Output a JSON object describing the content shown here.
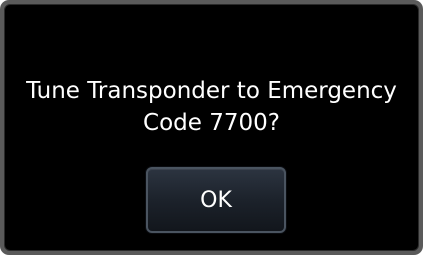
{
  "dialog": {
    "message_line1": "Tune Transponder to Emergency",
    "message_line2": "Code 7700?",
    "ok_label": "OK"
  },
  "colors": {
    "frame": "#5a5a5a",
    "background": "#000000",
    "text": "#ffffff",
    "button_border": "#4a5460",
    "button_fill": "#1c222b"
  }
}
